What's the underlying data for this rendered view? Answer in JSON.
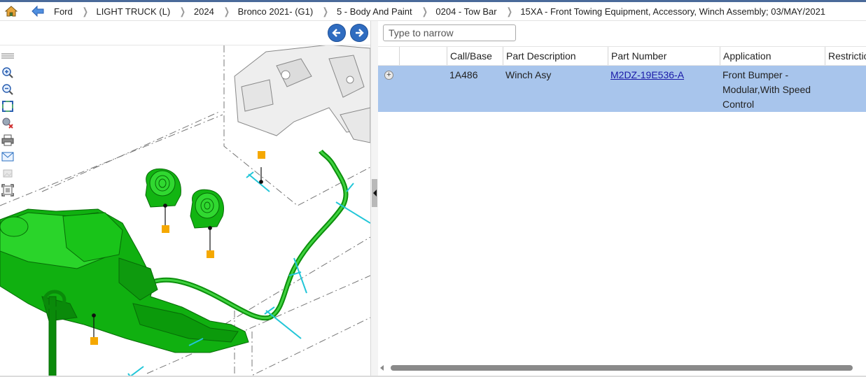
{
  "breadcrumb": {
    "items": [
      "Ford",
      "LIGHT TRUCK (L)",
      "2024",
      "Bronco 2021- (G1)",
      "5 - Body And Paint",
      "0204 - Tow Bar",
      "15XA - Front Towing Equipment, Accessory, Winch Assembly; 03/MAY/2021"
    ],
    "home_icon": "home-icon",
    "back_icon": "back-arrow-icon"
  },
  "diagram": {
    "nav": {
      "prev_icon": "arrow-left-icon",
      "next_icon": "arrow-right-icon"
    },
    "toolbar_icons": [
      "drag-handle-icon",
      "zoom-in-icon",
      "zoom-out-icon",
      "fit-to-screen-icon",
      "clear-selection-icon",
      "print-icon",
      "email-icon",
      "image-icon",
      "fullscreen-icon"
    ]
  },
  "parts": {
    "filter_placeholder": "Type to narrow",
    "columns": [
      "",
      "",
      "Call/Base",
      "Part Description",
      "Part Number",
      "Application",
      "Restrictio"
    ],
    "rows": [
      {
        "call_base": "1A486",
        "description": "Winch Asy",
        "part_number": "M2DZ-19E536-A",
        "application": "Front Bumper - Modular,With Speed Control",
        "restriction": ""
      }
    ]
  },
  "colors": {
    "selected_row": "#a8c5ec",
    "nav_button": "#2f6cc0",
    "part_green": "#12b512",
    "callout": "#f5a800",
    "hardware": "#22c6d8"
  }
}
